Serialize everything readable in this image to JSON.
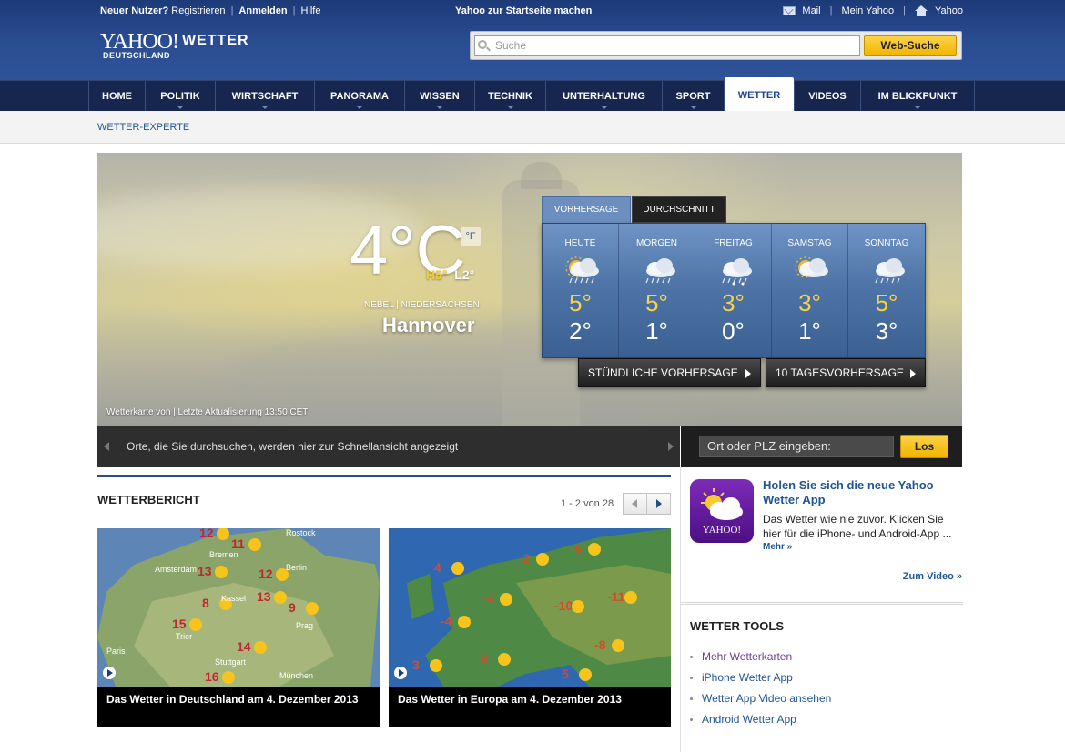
{
  "header": {
    "new_user": "Neuer Nutzer?",
    "register": "Registrieren",
    "sign_in": "Anmelden",
    "help": "Hilfe",
    "make_homepage": "Yahoo zur Startseite machen",
    "mail": "Mail",
    "my_yahoo": "Mein Yahoo",
    "yahoo": "Yahoo",
    "logo_brand": "YAHOO!",
    "logo_section": "WETTER",
    "logo_country": "DEUTSCHLAND",
    "search_placeholder": "Suche",
    "search_button": "Web-Suche"
  },
  "nav": {
    "items": [
      "HOME",
      "POLITIK",
      "WIRTSCHAFT",
      "PANORAMA",
      "WISSEN",
      "TECHNIK",
      "UNTERHALTUNG",
      "SPORT",
      "WETTER",
      "VIDEOS",
      "IM BLICKPUNKT"
    ],
    "active": "WETTER"
  },
  "subnav": {
    "item": "WETTER-EXPERTE"
  },
  "current": {
    "temp": "4°C",
    "unit_toggle": "°F",
    "high": "H5°",
    "low": "L2°",
    "condition": "NEBEL",
    "region": "NIEDERSACHSEN",
    "city": "Hannover",
    "credit": "Wetterkarte von | Letzte Aktualisierung 13:50 CET"
  },
  "forecast": {
    "tab_active": "VORHERSAGE",
    "tab_other": "DURCHSCHNITT",
    "days": [
      {
        "name": "HEUTE",
        "high": "5°",
        "low": "2°",
        "icon": "sun-cloud-rain-icon"
      },
      {
        "name": "MORGEN",
        "high": "5°",
        "low": "1°",
        "icon": "cloud-rain-icon"
      },
      {
        "name": "FREITAG",
        "high": "3°",
        "low": "0°",
        "icon": "cloud-snow-rain-icon"
      },
      {
        "name": "SAMSTAG",
        "high": "3°",
        "low": "1°",
        "icon": "sun-cloud-icon"
      },
      {
        "name": "SONNTAG",
        "high": "5°",
        "low": "3°",
        "icon": "cloud-rain-icon"
      }
    ],
    "hourly_button": "STÜNDLICHE VORHERSAGE",
    "tenday_button": "10 TAGESVORHERSAGE"
  },
  "locations": {
    "placeholder_text": "Orte, die Sie durchsuchen, werden hier zur Schnellansicht angezeigt",
    "input_placeholder": "Ort oder PLZ eingeben:",
    "go_button": "Los"
  },
  "report": {
    "title": "WETTERBERICHT",
    "pagination": "1 - 2 von 28",
    "cards": [
      {
        "caption": "Das Wetter in Deutschland am 4. Dezember 2013",
        "temps": [
          "12",
          "11",
          "13",
          "12",
          "8",
          "13",
          "9",
          "15",
          "14",
          "16"
        ],
        "cities": [
          "Bremen",
          "Amsterdam",
          "Berlin",
          "Kassel",
          "Prag",
          "Trier",
          "Paris",
          "Stuttgart",
          "München",
          "Rostock"
        ]
      },
      {
        "caption": "Das Wetter in Europa am 4. Dezember 2013",
        "temps": [
          "4",
          "-2",
          "-6",
          "-4",
          "-10",
          "-11",
          "-4",
          "-8",
          "3",
          "6",
          "5"
        ]
      }
    ]
  },
  "sidebar": {
    "app_icon_label": "YAHOO!",
    "app_title": "Holen Sie sich die neue Yahoo Wetter App",
    "app_text": "Das Wetter wie nie zuvor. Klicken Sie hier für die iPhone- und Android-App ...",
    "app_more": "Mehr »",
    "zum_video": "Zum Video »",
    "tools_title": "WETTER TOOLS",
    "tools": [
      "Mehr Wetterkarten",
      "iPhone Wetter App",
      "Wetter App Video ansehen",
      "Android Wetter App"
    ]
  },
  "colors": {
    "header_blue": "#2b4d92",
    "nav_dark": "#16264f",
    "link_blue": "#1f5594",
    "button_yellow": "#f2b400",
    "temp_high_yellow": "#f8d242"
  }
}
